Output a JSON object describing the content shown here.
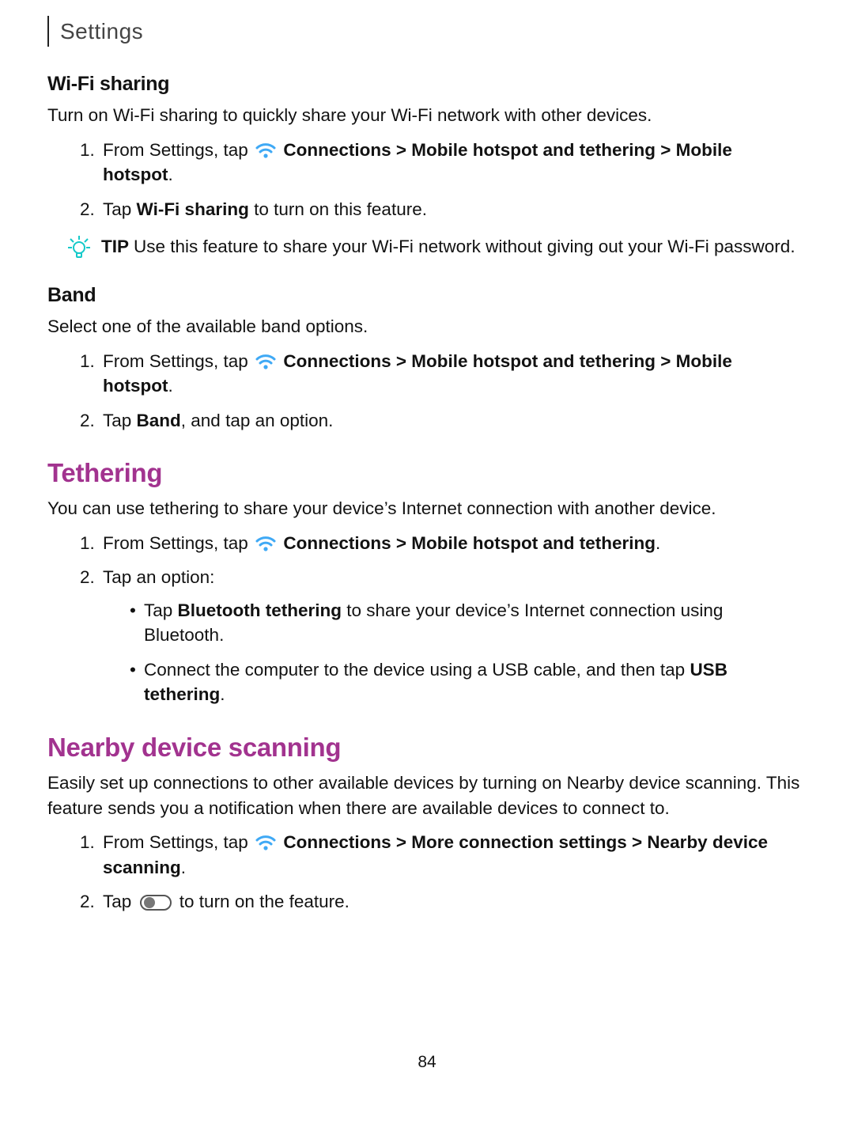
{
  "header": {
    "breadcrumb": "Settings"
  },
  "pageNumber": "84",
  "labels": {
    "tip": "TIP"
  },
  "wifiSharing": {
    "title": "Wi-Fi sharing",
    "intro": "Turn on Wi-Fi sharing to quickly share your Wi-Fi network with other devices.",
    "step1_pre": "From Settings, tap ",
    "step1_path": "Connections > Mobile hotspot and tethering > Mobile hotspot",
    "step1_post": ".",
    "step2_pre": "Tap ",
    "step2_bold": "Wi-Fi sharing",
    "step2_post": " to turn on this feature.",
    "tip": "Use this feature to share your Wi-Fi network without giving out your Wi-Fi password."
  },
  "band": {
    "title": "Band",
    "intro": "Select one of the available band options.",
    "step1_pre": "From Settings, tap ",
    "step1_path": "Connections > Mobile hotspot and tethering > Mobile hotspot",
    "step1_post": ".",
    "step2_pre": "Tap ",
    "step2_bold": "Band",
    "step2_post": ", and tap an option."
  },
  "tethering": {
    "title": "Tethering",
    "intro": "You can use tethering to share your device’s Internet connection with another device.",
    "step1_pre": "From Settings, tap ",
    "step1_path": "Connections > Mobile hotspot and tethering",
    "step1_post": ".",
    "step2": "Tap an option:",
    "bullet1_pre": "Tap ",
    "bullet1_bold": "Bluetooth tethering",
    "bullet1_post": " to share your device’s Internet connection using Bluetooth.",
    "bullet2_pre": "Connect the computer to the device using a USB cable, and then tap ",
    "bullet2_bold": "USB tethering",
    "bullet2_post": "."
  },
  "nearby": {
    "title": "Nearby device scanning",
    "intro": "Easily set up connections to other available devices by turning on Nearby device scanning. This feature sends you a notification when there are available devices to connect to.",
    "step1_pre": "From Settings, tap ",
    "step1_path": "Connections > More connection settings > Nearby device scanning",
    "step1_post": ".",
    "step2_pre": "Tap ",
    "step2_post": " to turn on the feature."
  }
}
